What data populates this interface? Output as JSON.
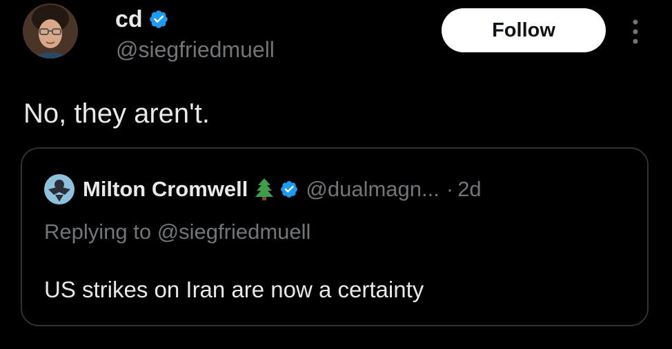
{
  "author": {
    "display_name": "cd",
    "handle": "@siegfriedmuell",
    "verified": true,
    "avatar_icon": "person-avatar"
  },
  "follow_button": {
    "label": "Follow"
  },
  "more_menu": {
    "icon": "more-vertical-icon"
  },
  "tweet": {
    "text": "No, they aren't."
  },
  "quoted_tweet": {
    "display_name": "Milton Cromwell",
    "emoji_icon": "evergreen-tree-icon",
    "verified": true,
    "handle": "@dualmagn...",
    "separator": "·",
    "time": "2d",
    "replying_to": "Replying to @siegfriedmuell",
    "text": "US strikes on Iran are now a certainty"
  },
  "colors": {
    "background": "#000000",
    "primary_text": "#e7e9ea",
    "secondary_text": "#71767b",
    "verified_blue": "#1d9bf0",
    "border": "#2f3336",
    "follow_button_bg": "#ffffff"
  }
}
